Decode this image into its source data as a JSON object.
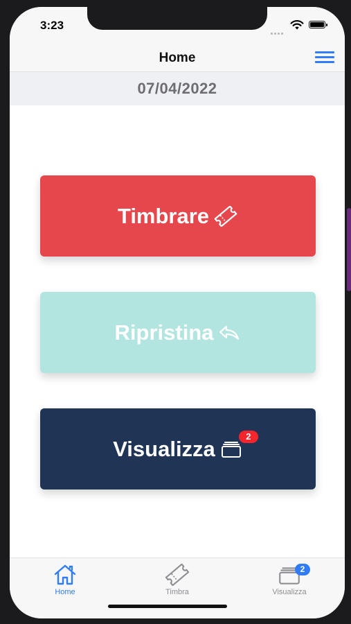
{
  "status_bar": {
    "time": "3:23"
  },
  "nav": {
    "title": "Home",
    "menu_icon": "hamburger-menu-icon"
  },
  "date": "07/04/2022",
  "actions": {
    "timbrare": {
      "label": "Timbrare",
      "icon": "ticket-icon",
      "color": "#e5474d"
    },
    "ripristina": {
      "label": "Ripristina",
      "icon": "undo-arrow-icon",
      "color": "#b2e5df"
    },
    "visualizza": {
      "label": "Visualizza",
      "icon": "cards-icon",
      "badge": "2",
      "color": "#203556"
    }
  },
  "tabs": [
    {
      "label": "Home",
      "icon": "home-icon",
      "active": true
    },
    {
      "label": "Timbra",
      "icon": "ticket-icon",
      "active": false
    },
    {
      "label": "Visualizza",
      "icon": "cards-icon",
      "badge": "2",
      "active": false
    }
  ],
  "colors": {
    "accent": "#2f7cf6",
    "badge": "#f5252c",
    "inactive_tab": "#8e8e93"
  }
}
